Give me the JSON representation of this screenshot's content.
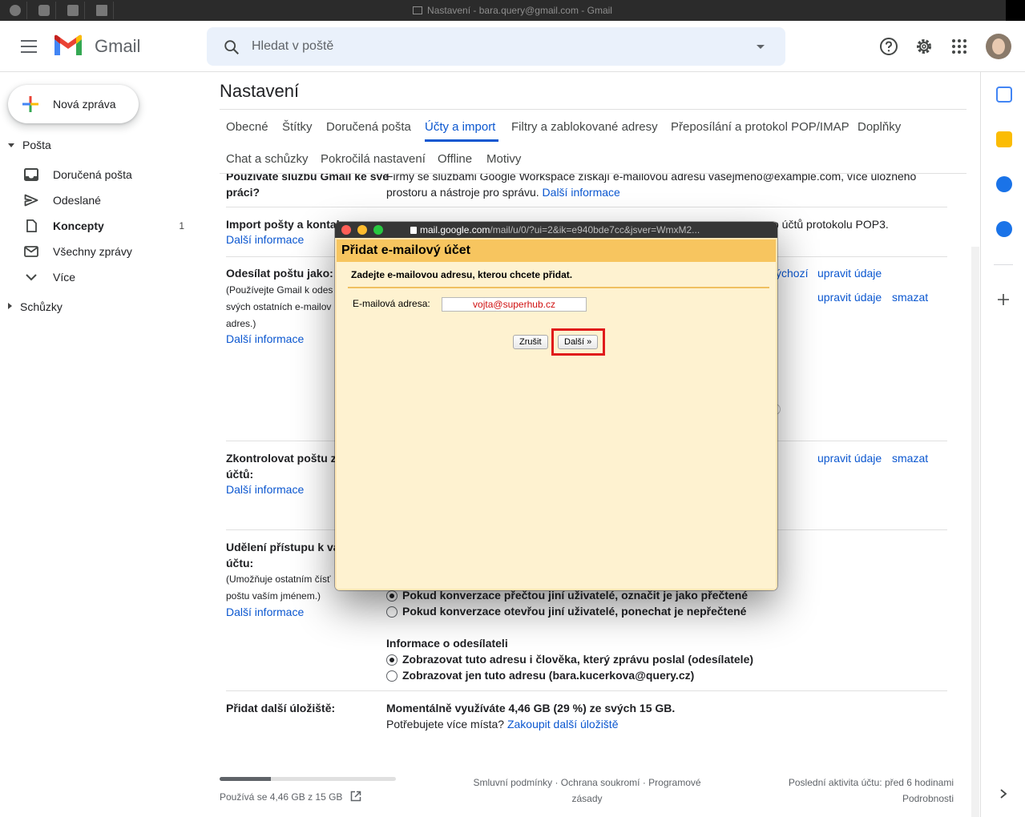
{
  "window": {
    "title": "Nastavení - bara.query@gmail.com - Gmail"
  },
  "header": {
    "app_name": "Gmail",
    "search_placeholder": "Hledat v poště",
    "icons": [
      "help-icon",
      "gear-icon",
      "apps-grid-icon",
      "avatar"
    ]
  },
  "sidebar": {
    "compose_label": "Nová zpráva",
    "section_mail": "Pošta",
    "items": [
      {
        "label": "Doručená pošta",
        "icon": "inbox-icon",
        "count": ""
      },
      {
        "label": "Odeslané",
        "icon": "send-icon",
        "count": ""
      },
      {
        "label": "Koncepty",
        "icon": "draft-icon",
        "count": "1"
      },
      {
        "label": "Všechny zprávy",
        "icon": "mail-icon",
        "count": ""
      },
      {
        "label": "Více",
        "icon": "chevron-down-icon",
        "count": ""
      }
    ],
    "section_meetings": "Schůzky"
  },
  "settings": {
    "title": "Nastavení",
    "tabs": [
      "Obecné",
      "Štítky",
      "Doručená pošta",
      "Účty a import",
      "Filtry a zablokované adresy",
      "Přeposílání a protokol POP/IMAP",
      "Doplňky",
      "Chat a schůzky",
      "Pokročilá nastavení",
      "Offline",
      "Motivy"
    ],
    "active_tab": "Účty a import",
    "rows": {
      "workspace": {
        "label_line1": "Používáte službu Gmail ke své",
        "label_line2": "práci?",
        "text_line1": "Firmy se službami Google Workspace získají e-mailovou adresu vasejmeno@example.com, více úložného",
        "text_line2": "prostoru a nástroje pro správu.",
        "link": "Další informace"
      },
      "import": {
        "label": "Import pošty a kontak",
        "text_tail": "o účtů protokolu POP3.",
        "link": "Další informace"
      },
      "send_as": {
        "label": "Odesílat poštu jako:",
        "sub_line1": "(Používejte Gmail k odes",
        "sub_line2": "svých ostatních e-mailov",
        "sub_line3": "adres.)",
        "link": "Další informace",
        "text_default_tail": "ýchozí",
        "edit_link": "upravit údaje",
        "delete_link": "smazat"
      },
      "check_mail": {
        "label_line1": "Zkontrolovat poštu z",
        "label_line2": "účtů:",
        "link": "Další informace",
        "edit_link": "upravit údaje",
        "delete_link": "smazat"
      },
      "grant_access": {
        "label_line1": "Udělení přístupu k va",
        "label_line2": "účtu:",
        "sub_line1": "(Umožňuje ostatním čísť",
        "sub_line2": "poštu vaším jménem.)",
        "link": "Další informace",
        "option_read": "Pokud konverzace přečtou jiní uživatelé, označit je jako přečtené",
        "option_unread": "Pokud konverzace otevřou jiní uživatelé, ponechat je nepřečtené",
        "sender_info_heading": "Informace o odesílateli",
        "option_show_both": "Zobrazovat tuto adresu i člověka, který zprávu poslal (odesílatele)",
        "option_show_only": "Zobrazovat jen tuto adresu (bara.kucerkova@query.cz)"
      },
      "storage": {
        "label": "Přidat další úložiště:",
        "text_bold": "Momentálně využíváte 4,46 GB (29 %) ze svých 15 GB.",
        "text_question": "Potřebujete více místa?",
        "link": "Zakoupit další úložiště"
      }
    }
  },
  "footer": {
    "storage_used_fraction": 0.29,
    "storage_text": "Používá se 4,46 GB z 15 GB",
    "terms_line1": "Smluvní podmínky · Ochrana soukromí · Programové",
    "terms_line2": "zásady",
    "activity_line1": "Poslední aktivita účtu: před 6 hodinami",
    "activity_line2": "Podrobnosti"
  },
  "popup": {
    "url_host": "mail.google.com",
    "url_path": "/mail/u/0/?ui=2&ik=e940bde7cc&jsver=WmxM2...",
    "heading": "Přidat e-mailový účet",
    "instruction": "Zadejte e-mailovou adresu, kterou chcete přidat.",
    "email_label": "E-mailová adresa:",
    "email_value": "vojta@superhub.cz",
    "cancel_label": "Zrušit",
    "next_label": "Další »"
  },
  "colors": {
    "accent_blue": "#0b57d0",
    "popup_header": "#f7c55f",
    "popup_body": "#fef2d0",
    "highlight_red": "#e01b1b"
  }
}
